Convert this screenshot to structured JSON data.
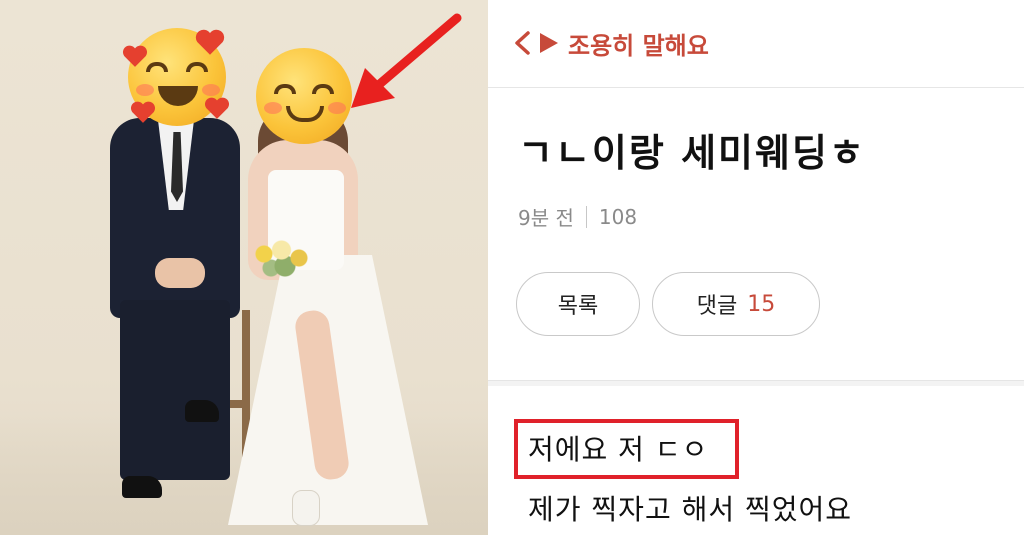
{
  "photo": {
    "stickers": {
      "groom_face": "smiling-face-with-hearts-icon",
      "bride_face": "smiling-face-icon",
      "pointer": "red-arrow-icon"
    },
    "colors": {
      "arrow": "#e8211f",
      "heart": "#e5402f"
    }
  },
  "header": {
    "back_icon": "chevron-left-icon",
    "board_icon": "play-triangle-icon",
    "board_name": "조용히 말해요",
    "accent": "#c74a3a"
  },
  "post": {
    "title": "ㄱㄴ이랑 세미웨딩ㅎ",
    "time_ago": "9분 전",
    "views": "108",
    "list_button": "목록",
    "comment_label": "댓글",
    "comment_count": "15",
    "body_line1": "저에요 저 ㄷㅇ",
    "body_line2": "제가 찍자고 해서 찍었어요"
  }
}
